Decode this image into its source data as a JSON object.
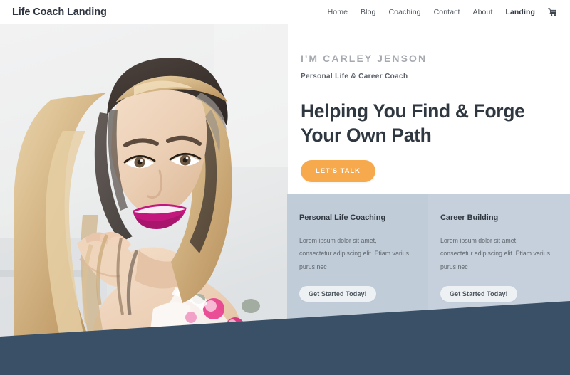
{
  "header": {
    "brand": "Life Coach Landing",
    "nav": [
      {
        "label": "Home",
        "active": false
      },
      {
        "label": "Blog",
        "active": false
      },
      {
        "label": "Coaching",
        "active": false
      },
      {
        "label": "Contact",
        "active": false
      },
      {
        "label": "About",
        "active": false
      },
      {
        "label": "Landing",
        "active": true
      }
    ],
    "cart_icon": "shopping-cart-icon"
  },
  "hero": {
    "photo_alt": "Smiling woman with long blonde and dark hair wearing a pink floral top",
    "eyebrow": "I'M CARLEY JENSON",
    "tagline": "Personal Life & Career Coach",
    "title_line_1": "Helping You Find & Forge",
    "title_line_2": "Your Own Path",
    "cta_label": "LET'S TALK"
  },
  "services": [
    {
      "title": "Personal Life Coaching",
      "body": "Lorem ipsum dolor sit amet, consectetur adipiscing elit. Etiam varius purus nec",
      "button_label": "Get Started Today!"
    },
    {
      "title": "Career Building",
      "body": "Lorem ipsum dolor sit amet, consectetur adipiscing elit. Etiam varius purus nec",
      "button_label": "Get Started Today!"
    }
  ],
  "colors": {
    "accent_orange": "#f7a94e",
    "footer_navy": "#3a5066",
    "card_blue": "#c2cdda",
    "text_dark": "#2f3740",
    "text_muted": "#60686f",
    "eyebrow_gray": "#a6aab0"
  }
}
